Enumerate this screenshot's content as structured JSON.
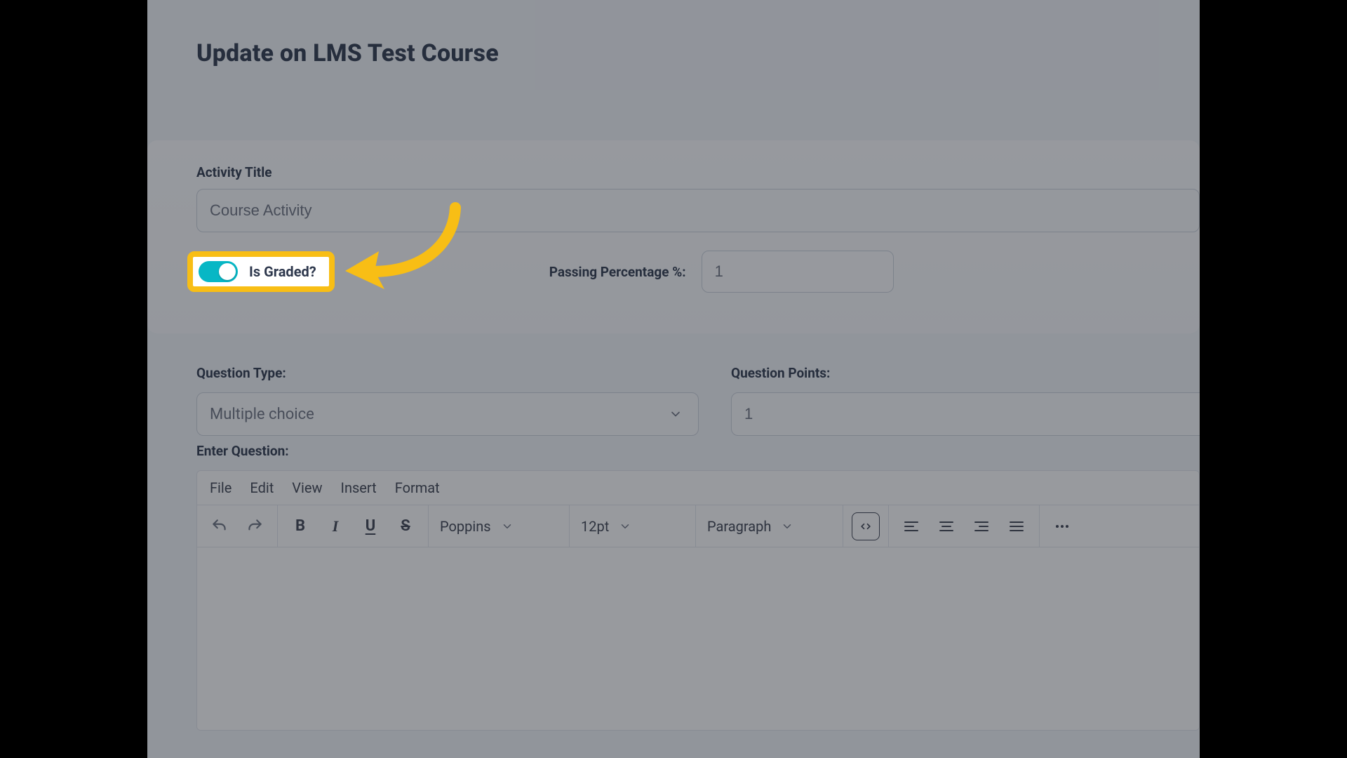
{
  "page": {
    "title": "Update on LMS Test Course",
    "activity": {
      "title_label": "Activity Title",
      "title_value": "Course Activity",
      "is_graded_label": "Is Graded?",
      "is_graded_on": true,
      "passing_label": "Passing Percentage %:",
      "passing_value": "1"
    },
    "question": {
      "type_label": "Question Type:",
      "type_value": "Multiple choice",
      "points_label": "Question Points:",
      "points_value": "1",
      "enter_label": "Enter Question:"
    },
    "editor": {
      "menu": [
        "File",
        "Edit",
        "View",
        "Insert",
        "Format"
      ],
      "font_family": "Poppins",
      "font_size": "12pt",
      "block_format": "Paragraph"
    }
  },
  "colors": {
    "highlight": "#F8BE15",
    "toggle_on": "#07B7C5",
    "text_dark": "#2E384D"
  }
}
